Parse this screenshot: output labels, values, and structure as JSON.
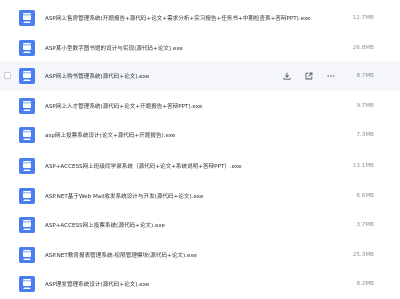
{
  "files": [
    {
      "name": "ASP网上售房管理系统(开题报告+源代码+论文+需求分析+实习报告+任务书+中期检查表+答辩PPT).exe",
      "size": "12.7MB"
    },
    {
      "name": "ASP某小型数字图书馆的设计与实现(源代码+论文).exe",
      "size": "26.8MB"
    },
    {
      "name": "ASP网上购书管理系统(源代码+论文).exe",
      "size": "8.7MB"
    },
    {
      "name": "ASP网上人才管理系统(源代码+论文+开题报告+答辩PPT).exe",
      "size": "9.7MB"
    },
    {
      "name": "asp网上投票系统设计(论文+源代码+开题报告).exe",
      "size": "7.3MB"
    },
    {
      "name": "ASP+ACCESS网上班级同学录系统（源代码+论文+系统说明+答辩PPT）.exe",
      "size": "13.1MB"
    },
    {
      "name": "ASP.NET基于Web Mail收发系统设计与开发(源代码+论文).exe",
      "size": "6.6MB"
    },
    {
      "name": "ASP+ACCESS网上投票系统(源代码+论文).exe",
      "size": "3.7MB"
    },
    {
      "name": "ASP.NET教育报表管理系统-权限管理模块(源代码+论文).exe",
      "size": "25.3MB"
    },
    {
      "name": "ASP理发管理系统设计(源代码+论文).exe",
      "size": "8.2MB"
    }
  ],
  "icons": {
    "file": "windows-installer-file-icon",
    "download": "download-icon",
    "share": "share-icon",
    "more": "more-icon"
  },
  "colors": {
    "icon_blue": "#4a7df0",
    "hover_row": "#f4f6fa"
  }
}
